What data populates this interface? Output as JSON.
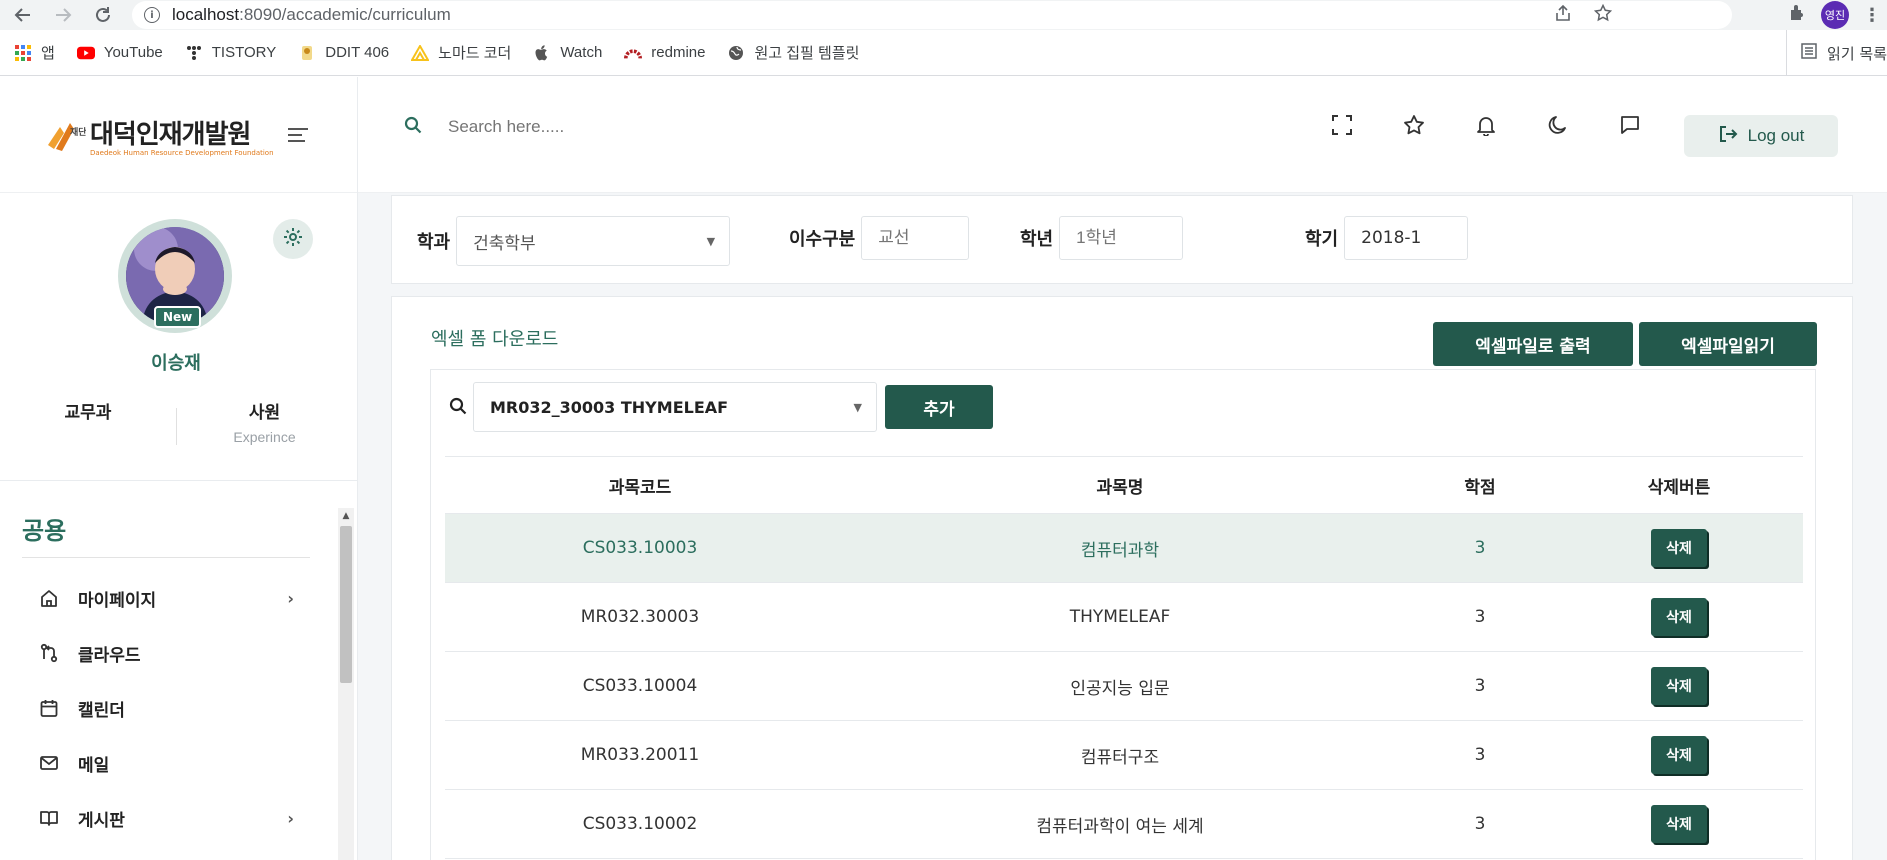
{
  "browser": {
    "url_host": "localhost",
    "url_path": ":8090/accademic/curriculum",
    "profile_badge": "영진",
    "bookmarks": [
      {
        "label": "앱",
        "icon": "apps-grid-icon",
        "color": "#ea4335"
      },
      {
        "label": "YouTube",
        "icon": "youtube-icon",
        "color": "#ff0000"
      },
      {
        "label": "TISTORY",
        "icon": "tistory-icon",
        "color": "#333333"
      },
      {
        "label": "DDIT 406",
        "icon": "ddit-icon",
        "color": "#f2b705"
      },
      {
        "label": "노마드 코더",
        "icon": "nomad-icon",
        "color": "#f7c21b"
      },
      {
        "label": "Watch",
        "icon": "apple-icon",
        "color": "#555555"
      },
      {
        "label": "redmine",
        "icon": "redmine-icon",
        "color": "#b32024"
      },
      {
        "label": "원고 집필 템플릿",
        "icon": "globe-icon",
        "color": "#555555"
      }
    ],
    "reading_list": "읽기 목록"
  },
  "header": {
    "logo_text": "대덕인재개발원",
    "logo_sub": "Daedeok Human Resource Development Foundation",
    "logo_seal": "재단법인",
    "search_placeholder": "Search here.....",
    "logout_label": "Log out"
  },
  "profile": {
    "badge": "New",
    "name": "이승재",
    "department": "교무과",
    "position": "사원",
    "position_label": "Experince"
  },
  "menu": {
    "title": "공용",
    "items": [
      {
        "label": "마이페이지",
        "icon": "home-icon",
        "has_children": true
      },
      {
        "label": "클라우드",
        "icon": "git-compare-icon",
        "has_children": false
      },
      {
        "label": "캘린더",
        "icon": "calendar-icon",
        "has_children": false
      },
      {
        "label": "메일",
        "icon": "mail-icon",
        "has_children": false
      },
      {
        "label": "게시판",
        "icon": "book-icon",
        "has_children": true
      }
    ]
  },
  "filters": {
    "department_label": "학과",
    "department_value": "건축학부",
    "category_label": "이수구분",
    "category_placeholder": "교선",
    "grade_label": "학년",
    "grade_placeholder": "1학년",
    "semester_label": "학기",
    "semester_value": "2018-1"
  },
  "content": {
    "excel_download": "엑셀 폼 다운로드",
    "excel_export": "엑셀파일로 출력",
    "excel_read": "엑셀파일읽기",
    "subject_selected": "MR032_30003 THYMELEAF",
    "add_label": "추가"
  },
  "table": {
    "headers": [
      "과목코드",
      "과목명",
      "학점",
      "삭제버튼"
    ],
    "delete_label": "삭제",
    "rows": [
      {
        "code": "CS033.10003",
        "name": "컴퓨터과학",
        "credit": "3"
      },
      {
        "code": "MR032.30003",
        "name": "THYMELEAF",
        "credit": "3"
      },
      {
        "code": "CS033.10004",
        "name": "인공지능 입문",
        "credit": "3"
      },
      {
        "code": "MR033.20011",
        "name": "컴퓨터구조",
        "credit": "3"
      },
      {
        "code": "CS033.10002",
        "name": "컴퓨터과학이 여는 세계",
        "credit": "3"
      }
    ]
  },
  "colors": {
    "brand": "#23594c",
    "accent": "#2c6e5e",
    "highlight_row": "#e9f0ed"
  }
}
